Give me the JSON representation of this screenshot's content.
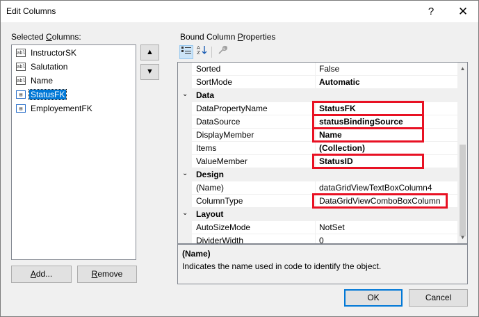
{
  "window": {
    "title": "Edit Columns",
    "help_icon": "?",
    "close_icon": "✕"
  },
  "left": {
    "selected_columns_label_prefix": "Selected ",
    "selected_columns_label_access": "C",
    "selected_columns_label_suffix": "olumns:",
    "columns": [
      {
        "label": "InstructorSK",
        "icon": "textbox-column-icon",
        "selected": false
      },
      {
        "label": "Salutation",
        "icon": "textbox-column-icon",
        "selected": false
      },
      {
        "label": "Name",
        "icon": "textbox-column-icon",
        "selected": false
      },
      {
        "label": "StatusFK",
        "icon": "combobox-column-icon",
        "selected": true
      },
      {
        "label": "EmployementFK",
        "icon": "combobox-column-icon",
        "selected": false
      }
    ],
    "move_up_icon": "▲",
    "move_down_icon": "▼",
    "add_access": "A",
    "add_rest": "dd...",
    "remove_access": "R",
    "remove_rest": "emove"
  },
  "right": {
    "label_prefix": "Bound Column ",
    "label_access": "P",
    "label_suffix": "roperties",
    "toolbar": {
      "categorized_icon": "categorized-icon",
      "alphabetical_icon": "alphabetical-icon",
      "property_pages_icon": "wrench-icon"
    },
    "rows": [
      {
        "type": "prop",
        "name": "Sorted",
        "value": "False",
        "bold": false
      },
      {
        "type": "prop",
        "name": "SortMode",
        "value": "Automatic",
        "bold": true
      },
      {
        "type": "cat",
        "name": "Data",
        "expander": "⌄"
      },
      {
        "type": "prop",
        "name": "DataPropertyName",
        "value": "StatusFK",
        "bold": true
      },
      {
        "type": "prop",
        "name": "DataSource",
        "value": "statusBindingSource",
        "bold": true
      },
      {
        "type": "prop",
        "name": "DisplayMember",
        "value": "Name",
        "bold": true
      },
      {
        "type": "prop",
        "name": "Items",
        "value": "(Collection)",
        "bold": true
      },
      {
        "type": "prop",
        "name": "ValueMember",
        "value": "StatusID",
        "bold": true
      },
      {
        "type": "cat",
        "name": "Design",
        "expander": "⌄"
      },
      {
        "type": "prop",
        "name": "(Name)",
        "value": "dataGridViewTextBoxColumn4",
        "bold": false
      },
      {
        "type": "prop",
        "name": "ColumnType",
        "value": "DataGridViewComboBoxColumn",
        "bold": false
      },
      {
        "type": "cat",
        "name": "Layout",
        "expander": "⌄"
      },
      {
        "type": "prop",
        "name": "AutoSizeMode",
        "value": "NotSet",
        "bold": false
      },
      {
        "type": "prop",
        "name": "DividerWidth",
        "value": "0",
        "bold": false
      }
    ],
    "highlight_color": "#e81123",
    "description": {
      "title": "(Name)",
      "text": "Indicates the name used in code to identify the object."
    }
  },
  "footer": {
    "ok_label": "OK",
    "cancel_label": "Cancel"
  },
  "colors": {
    "selection": "#0078d7",
    "dialog_bg": "#f0f0f0",
    "highlight": "#e81123"
  }
}
